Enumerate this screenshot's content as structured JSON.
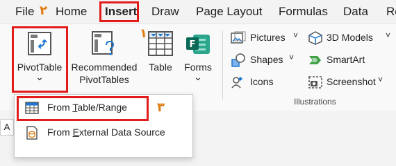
{
  "menubar": {
    "tabs": [
      {
        "label": "File"
      },
      {
        "label": "Home"
      },
      {
        "label": "Insert",
        "active": true
      },
      {
        "label": "Draw"
      },
      {
        "label": "Page Layout"
      },
      {
        "label": "Formulas"
      },
      {
        "label": "Data"
      },
      {
        "label": "Re"
      }
    ]
  },
  "annotations": {
    "marker_1": "١",
    "marker_2": "٢",
    "marker_3": "٣",
    "highlight_color": "#e21b1b",
    "marker_color": "#e07a10"
  },
  "ribbon": {
    "pivottable": {
      "label": "PivotTable",
      "icon": "pivottable-icon",
      "chevron": "⌄"
    },
    "recommended": {
      "line1": "Recommended",
      "line2": "PivotTables",
      "icon": "recommended-pivottables-icon"
    },
    "table": {
      "label": "Table",
      "icon": "table-grid-icon"
    },
    "forms": {
      "label": "Forms",
      "icon": "forms-icon",
      "chevron": "⌄"
    },
    "illustrations": {
      "group_label": "Illustrations",
      "items": [
        {
          "label": "Pictures",
          "icon": "pictures-icon",
          "chevron": "˅"
        },
        {
          "label": "Shapes",
          "icon": "shapes-icon",
          "chevron": "˅"
        },
        {
          "label": "Icons",
          "icon": "icons-icon"
        },
        {
          "label": "3D Models",
          "icon": "3d-models-icon",
          "chevron": "˅"
        },
        {
          "label": "SmartArt",
          "icon": "smartart-icon"
        },
        {
          "label": "Screenshot",
          "icon": "screenshot-icon",
          "chevron": "˅"
        }
      ]
    }
  },
  "dropdown": {
    "items": [
      {
        "pre": "From ",
        "ul": "T",
        "post": "able/Range",
        "icon": "from-table-range-icon"
      },
      {
        "pre": "From ",
        "ul": "E",
        "post": "xternal Data Source",
        "icon": "external-data-source-icon"
      }
    ]
  },
  "formula_bar": {
    "stub": "A"
  }
}
